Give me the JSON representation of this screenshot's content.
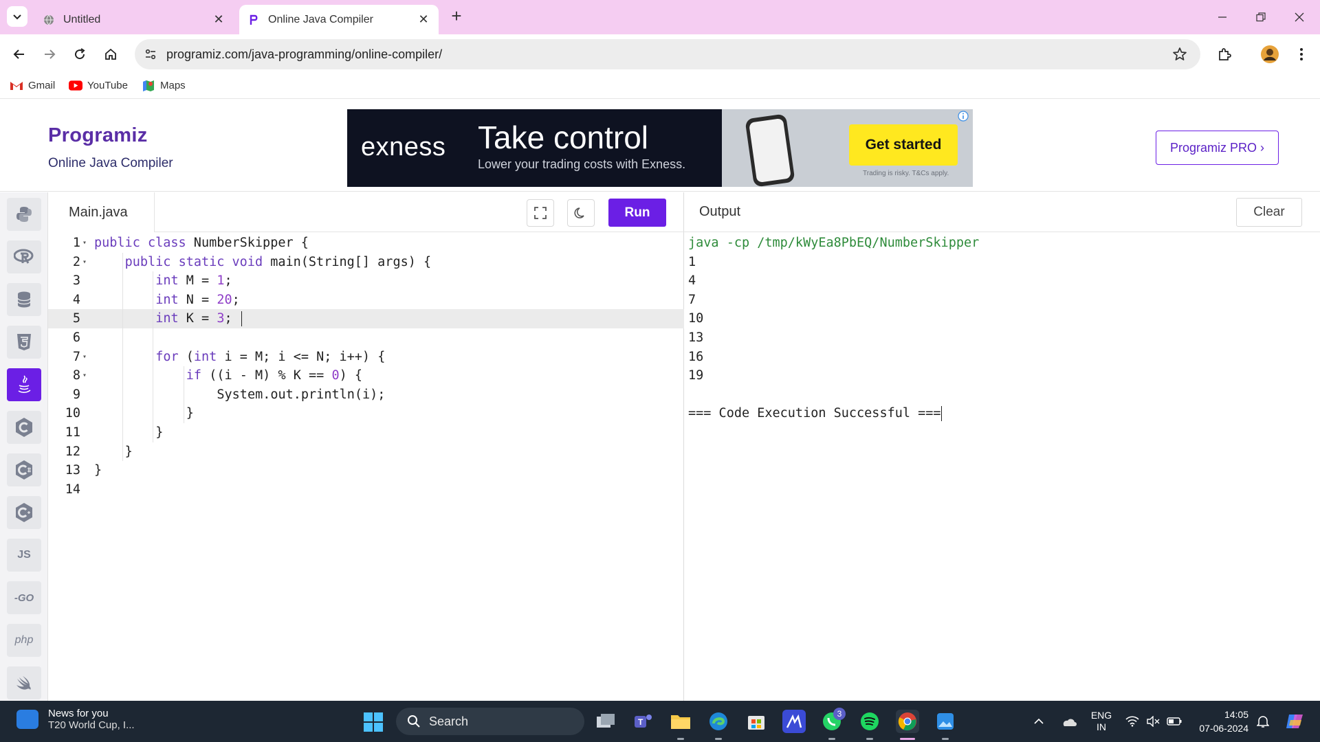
{
  "browser": {
    "tabs": [
      {
        "title": "Untitled",
        "active": false
      },
      {
        "title": "Online Java Compiler",
        "active": true
      }
    ],
    "url": "programiz.com/java-programming/online-compiler/",
    "bookmarks": [
      {
        "label": "Gmail",
        "icon": "gmail-icon"
      },
      {
        "label": "YouTube",
        "icon": "youtube-icon"
      },
      {
        "label": "Maps",
        "icon": "maps-icon"
      }
    ]
  },
  "site": {
    "logo": "Programiz",
    "subtitle": "Online Java Compiler",
    "pro_label": "Programiz PRO ›"
  },
  "ad": {
    "brand": "exness",
    "title": "Take control",
    "subtitle": "Lower your trading costs with Exness.",
    "cta": "Get started",
    "disclaimer": "Trading is risky. T&Cs apply."
  },
  "languages": [
    {
      "name": "python",
      "label": "",
      "active": false
    },
    {
      "name": "r",
      "label": "R",
      "active": false
    },
    {
      "name": "sql",
      "label": "",
      "active": false
    },
    {
      "name": "html",
      "label": "5",
      "active": false
    },
    {
      "name": "java",
      "label": "",
      "active": true
    },
    {
      "name": "c",
      "label": "C",
      "active": false
    },
    {
      "name": "csharp",
      "label": "C",
      "active": false
    },
    {
      "name": "cpp",
      "label": "C",
      "active": false
    },
    {
      "name": "javascript",
      "label": "JS",
      "active": false
    },
    {
      "name": "go",
      "label": "-GO",
      "active": false
    },
    {
      "name": "php",
      "label": "php",
      "active": false
    },
    {
      "name": "swift",
      "label": "",
      "active": false
    }
  ],
  "editor": {
    "file_tab": "Main.java",
    "run_label": "Run",
    "current_line": 5,
    "lines": [
      {
        "n": "1",
        "fold": true,
        "indent": 0,
        "tokens": [
          [
            "kw",
            "public"
          ],
          [
            "t",
            " "
          ],
          [
            "kw",
            "class"
          ],
          [
            "t",
            " NumberSkipper {"
          ]
        ]
      },
      {
        "n": "2",
        "fold": true,
        "indent": 1,
        "tokens": [
          [
            "kw",
            "public"
          ],
          [
            "t",
            " "
          ],
          [
            "kw",
            "static"
          ],
          [
            "t",
            " "
          ],
          [
            "kw",
            "void"
          ],
          [
            "t",
            " main(String[] args) {"
          ]
        ]
      },
      {
        "n": "3",
        "fold": false,
        "indent": 2,
        "tokens": [
          [
            "kw",
            "int"
          ],
          [
            "t",
            " M = "
          ],
          [
            "nm",
            "1"
          ],
          [
            "t",
            ";"
          ]
        ]
      },
      {
        "n": "4",
        "fold": false,
        "indent": 2,
        "tokens": [
          [
            "kw",
            "int"
          ],
          [
            "t",
            " N = "
          ],
          [
            "nm",
            "20"
          ],
          [
            "t",
            ";"
          ]
        ]
      },
      {
        "n": "5",
        "fold": false,
        "indent": 2,
        "tokens": [
          [
            "kw",
            "int"
          ],
          [
            "t",
            " K = "
          ],
          [
            "nm",
            "3"
          ],
          [
            "t",
            "; "
          ]
        ]
      },
      {
        "n": "6",
        "fold": false,
        "indent": 0,
        "tokens": []
      },
      {
        "n": "7",
        "fold": true,
        "indent": 2,
        "tokens": [
          [
            "kw",
            "for"
          ],
          [
            "t",
            " ("
          ],
          [
            "kw",
            "int"
          ],
          [
            "t",
            " i = M; i <= N; i++) {"
          ]
        ]
      },
      {
        "n": "8",
        "fold": true,
        "indent": 3,
        "tokens": [
          [
            "kw",
            "if"
          ],
          [
            "t",
            " ((i - M) % K == "
          ],
          [
            "nm",
            "0"
          ],
          [
            "t",
            ") {"
          ]
        ]
      },
      {
        "n": "9",
        "fold": false,
        "indent": 4,
        "tokens": [
          [
            "t",
            "System.out.println(i);"
          ]
        ]
      },
      {
        "n": "10",
        "fold": false,
        "indent": 3,
        "tokens": [
          [
            "t",
            "}"
          ]
        ]
      },
      {
        "n": "11",
        "fold": false,
        "indent": 2,
        "tokens": [
          [
            "t",
            "}"
          ]
        ]
      },
      {
        "n": "12",
        "fold": false,
        "indent": 1,
        "tokens": [
          [
            "t",
            "}"
          ]
        ]
      },
      {
        "n": "13",
        "fold": false,
        "indent": 0,
        "tokens": [
          [
            "t",
            "}"
          ]
        ]
      },
      {
        "n": "14",
        "fold": false,
        "indent": 0,
        "tokens": []
      }
    ]
  },
  "output": {
    "title": "Output",
    "clear_label": "Clear",
    "command": "java -cp /tmp/kWyEa8PbEQ/NumberSkipper",
    "lines": [
      "1",
      "4",
      "7",
      "10",
      "13",
      "16",
      "19",
      "",
      "=== Code Execution Successful ==="
    ]
  },
  "taskbar": {
    "news_title": "News for you",
    "news_sub": "T20 World Cup, I...",
    "search_label": "Search",
    "whatsapp_badge": "3",
    "lang_line1": "ENG",
    "lang_line2": "IN",
    "time": "14:05",
    "date": "07-06-2024"
  },
  "colors": {
    "accent": "#6b1fe5",
    "tabstrip": "#f5cdf2",
    "taskbar": "#1d2733",
    "command_green": "#2e8b3a"
  }
}
